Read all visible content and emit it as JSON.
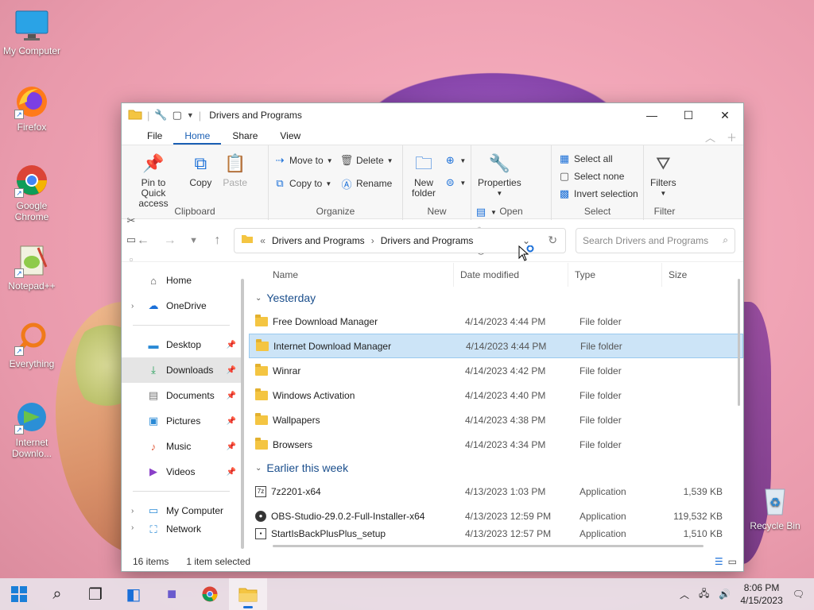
{
  "desktop": {
    "icons": [
      {
        "label": "My Computer"
      },
      {
        "label": "Firefox"
      },
      {
        "label": "Google Chrome"
      },
      {
        "label": "Notepad++"
      },
      {
        "label": "Everything"
      },
      {
        "label": "Internet Downlo..."
      },
      {
        "label": "Recycle Bin"
      }
    ]
  },
  "window": {
    "title": "Drivers and Programs",
    "menu": [
      "File",
      "Home",
      "Share",
      "View"
    ],
    "ribbon": {
      "clipboard": {
        "name": "Clipboard",
        "pin": "Pin to Quick access",
        "copy": "Copy",
        "paste": "Paste"
      },
      "organize": {
        "name": "Organize",
        "move_to": "Move to",
        "copy_to": "Copy to",
        "delete": "Delete",
        "rename": "Rename"
      },
      "new": {
        "name": "New",
        "new_folder": "New folder"
      },
      "open": {
        "name": "Open",
        "properties": "Properties"
      },
      "select": {
        "name": "Select",
        "select_all": "Select all",
        "select_none": "Select none",
        "invert": "Invert selection"
      },
      "filter": {
        "name": "Filter",
        "filters": "Filters"
      }
    },
    "address": {
      "crumbs": [
        "Drivers and Programs",
        "Drivers and Programs"
      ],
      "prefix": "«"
    },
    "search": {
      "placeholder": "Search Drivers and Programs"
    },
    "sidebar": [
      {
        "label": "Home",
        "icon": "home-icon",
        "glyph": "⌂"
      },
      {
        "label": "OneDrive",
        "icon": "cloud-icon",
        "glyph": "☁"
      },
      {
        "label": "Desktop",
        "icon": "desktop-icon",
        "glyph": "▭"
      },
      {
        "label": "Downloads",
        "icon": "download-icon",
        "glyph": "⤓"
      },
      {
        "label": "Documents",
        "icon": "document-icon",
        "glyph": "▤"
      },
      {
        "label": "Pictures",
        "icon": "picture-icon",
        "glyph": "▣"
      },
      {
        "label": "Music",
        "icon": "music-icon",
        "glyph": "♪"
      },
      {
        "label": "Videos",
        "icon": "video-icon",
        "glyph": "▶"
      },
      {
        "label": "My Computer",
        "icon": "computer-icon",
        "glyph": "▭"
      },
      {
        "label": "Network",
        "icon": "network-icon",
        "glyph": "⛶"
      }
    ],
    "columns": [
      "Name",
      "Date modified",
      "Type",
      "Size"
    ],
    "groups": [
      {
        "label": "Yesterday",
        "rows": [
          {
            "name": "Free Download Manager",
            "date": "4/14/2023 4:44 PM",
            "type": "File folder",
            "size": ""
          },
          {
            "name": "Internet Download Manager",
            "date": "4/14/2023 4:44 PM",
            "type": "File folder",
            "size": ""
          },
          {
            "name": "Winrar",
            "date": "4/14/2023 4:42 PM",
            "type": "File folder",
            "size": ""
          },
          {
            "name": "Windows Activation",
            "date": "4/14/2023 4:40 PM",
            "type": "File folder",
            "size": ""
          },
          {
            "name": "Wallpapers",
            "date": "4/14/2023 4:38 PM",
            "type": "File folder",
            "size": ""
          },
          {
            "name": "Browsers",
            "date": "4/14/2023 4:34 PM",
            "type": "File folder",
            "size": ""
          }
        ]
      },
      {
        "label": "Earlier this week",
        "rows": [
          {
            "name": "7z2201-x64",
            "date": "4/13/2023 1:03 PM",
            "type": "Application",
            "size": "1,539 KB"
          },
          {
            "name": "OBS-Studio-29.0.2-Full-Installer-x64",
            "date": "4/13/2023 12:59 PM",
            "type": "Application",
            "size": "119,532 KB"
          },
          {
            "name": "StartIsBackPlusPlus_setup",
            "date": "4/13/2023 12:57 PM",
            "type": "Application",
            "size": "1,510 KB"
          }
        ]
      }
    ],
    "status": {
      "count": "16 items",
      "selected": "1 item selected"
    }
  },
  "taskbar": {
    "time": "8:06 PM",
    "date": "4/15/2023"
  }
}
